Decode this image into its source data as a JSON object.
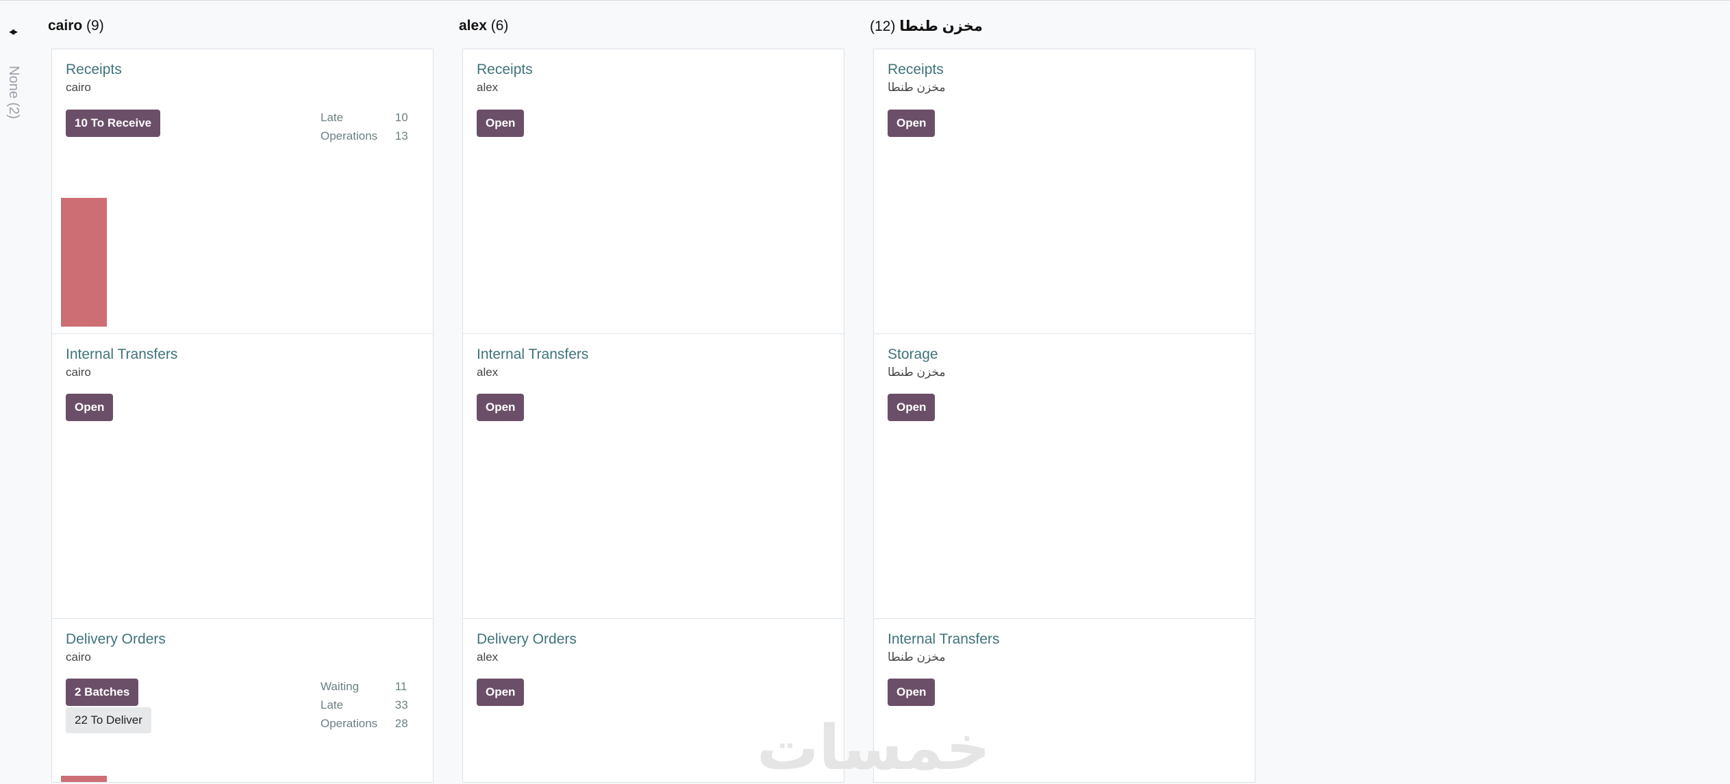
{
  "folded_column": {
    "toggle_icon": "◂▸",
    "label": "None (2)"
  },
  "groups": [
    {
      "name": "cairo",
      "count": "(9)"
    },
    {
      "name": "alex",
      "count": "(6)"
    },
    {
      "name": "مخزن طنطا",
      "count": "(12)"
    }
  ],
  "cards": {
    "cairo_receipts": {
      "title": "Receipts",
      "warehouse": "cairo",
      "button": "10 To Receive",
      "stats": [
        {
          "label": "Late",
          "value": "10"
        },
        {
          "label": "Operations",
          "value": "13"
        }
      ]
    },
    "cairo_internal": {
      "title": "Internal Transfers",
      "warehouse": "cairo",
      "button": "Open"
    },
    "cairo_delivery": {
      "title": "Delivery Orders",
      "warehouse": "cairo",
      "button": "2 Batches",
      "button2": "22 To Deliver",
      "stats": [
        {
          "label": "Waiting",
          "value": "11"
        },
        {
          "label": "Late",
          "value": "33"
        },
        {
          "label": "Operations",
          "value": "28"
        }
      ]
    },
    "alex_receipts": {
      "title": "Receipts",
      "warehouse": "alex",
      "button": "Open"
    },
    "alex_internal": {
      "title": "Internal Transfers",
      "warehouse": "alex",
      "button": "Open"
    },
    "alex_delivery": {
      "title": "Delivery Orders",
      "warehouse": "alex",
      "button": "Open"
    },
    "tanta_receipts": {
      "title": "Receipts",
      "warehouse": "مخزن طنطا",
      "button": "Open"
    },
    "tanta_storage": {
      "title": "Storage",
      "warehouse": "مخزن طنطا",
      "button": "Open"
    },
    "tanta_internal": {
      "title": "Internal Transfers",
      "warehouse": "مخزن طنطا",
      "button": "Open"
    }
  },
  "watermark": "خمسات",
  "colors": {
    "primary_button": "#6b4f68",
    "title_link": "#3f7377",
    "graph_bar": "#cd6d74"
  }
}
